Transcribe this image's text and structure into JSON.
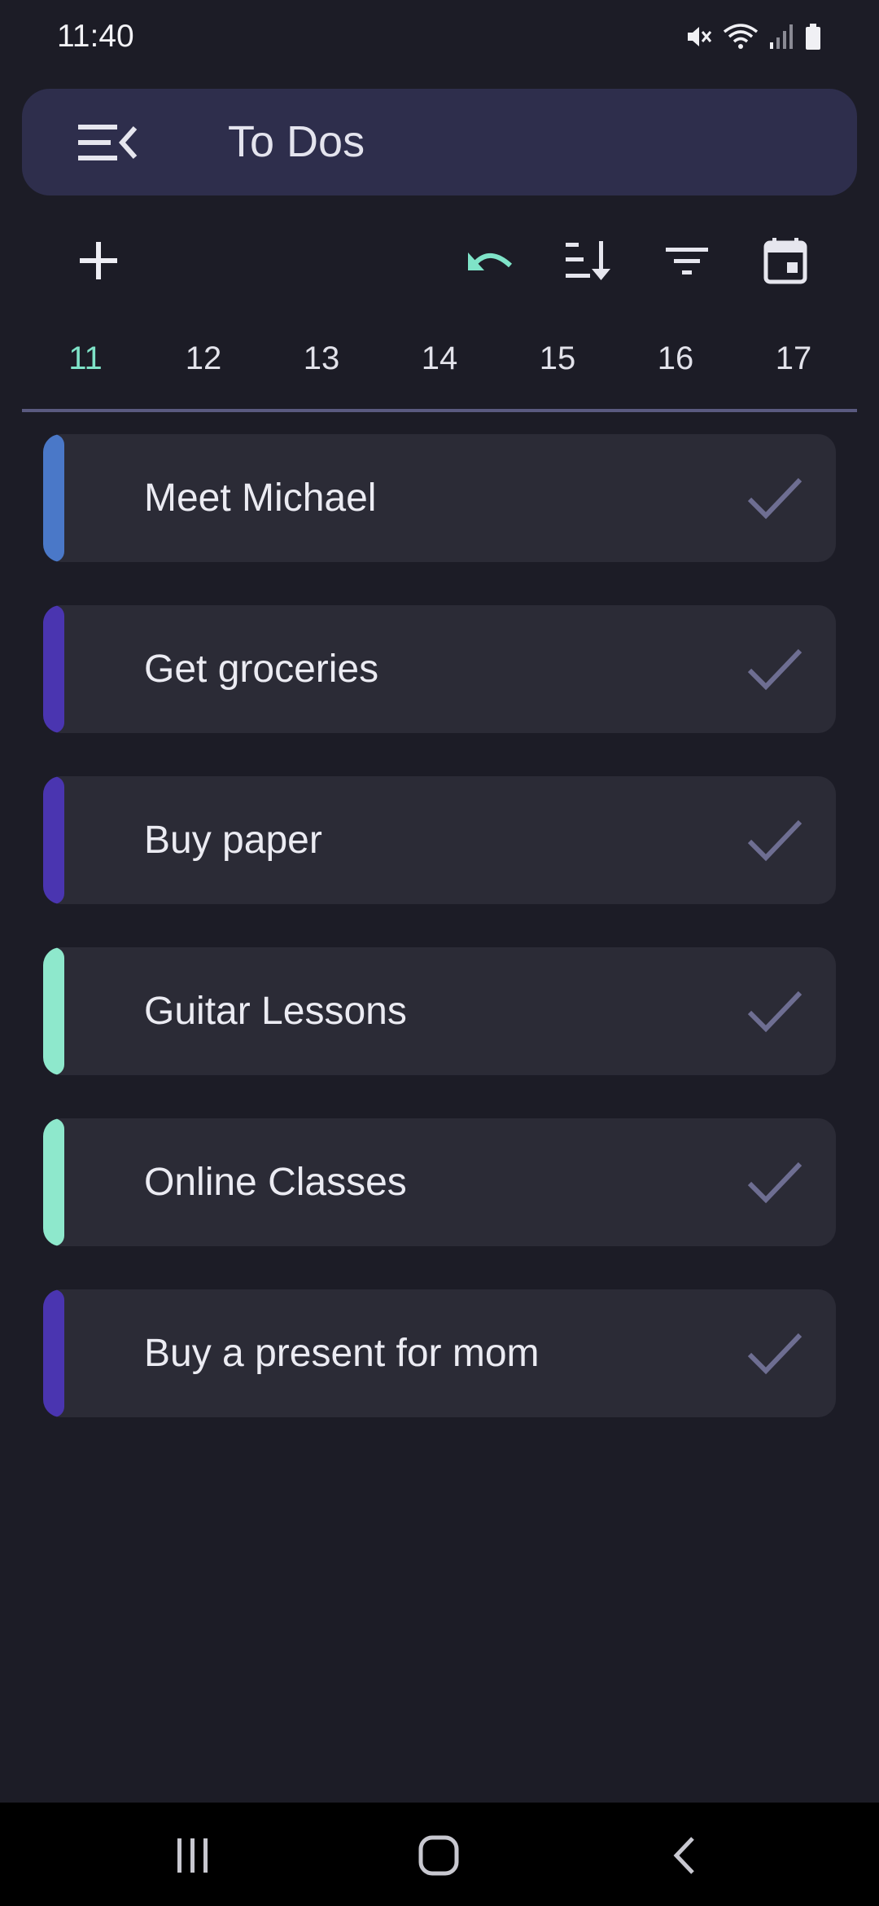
{
  "status_bar": {
    "time": "11:40",
    "icons": [
      "mute-icon",
      "wifi-icon",
      "signal-icon",
      "battery-icon"
    ]
  },
  "app_bar": {
    "title": "To Dos",
    "menu_icon": "menu-collapse-icon"
  },
  "toolbar": {
    "buttons": [
      "add-icon",
      "undo-icon",
      "sort-icon",
      "filter-icon",
      "calendar-icon"
    ],
    "accent_color": "#7fe3c8"
  },
  "date_tabs": {
    "days": [
      "11",
      "12",
      "13",
      "14",
      "15",
      "16",
      "17"
    ],
    "selected": "11"
  },
  "todos": [
    {
      "label": "Meet Michael",
      "color": "#4a78c8"
    },
    {
      "label": "Get groceries",
      "color": "#4a35b0"
    },
    {
      "label": "Buy paper",
      "color": "#4a35b0"
    },
    {
      "label": "Guitar Lessons",
      "color": "#8ee8cc"
    },
    {
      "label": "Online Classes",
      "color": "#8ee8cc"
    },
    {
      "label": "Buy a present for mom",
      "color": "#4a35b0"
    }
  ],
  "nav_bar": {
    "buttons": [
      "recents-icon",
      "home-icon",
      "back-icon"
    ]
  }
}
